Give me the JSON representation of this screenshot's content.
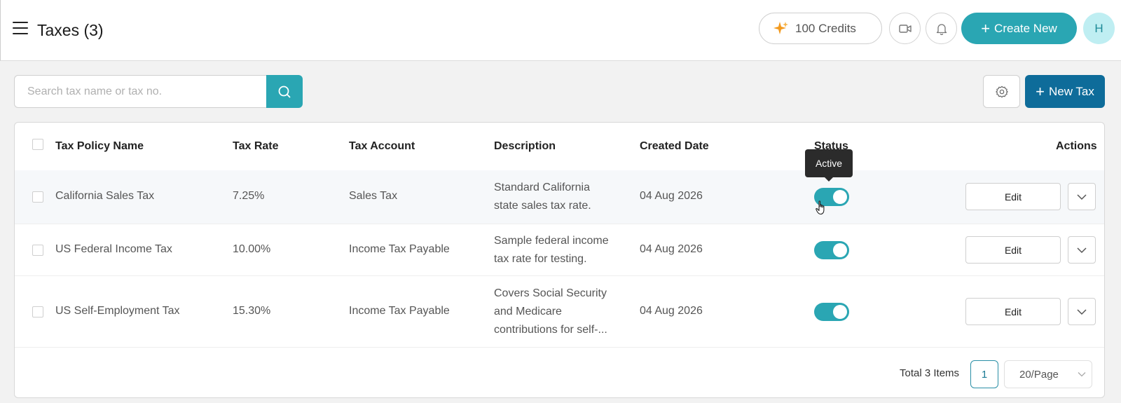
{
  "header": {
    "title": "Taxes (3)",
    "credits_label": "100 Credits",
    "create_label": "Create New",
    "avatar_initial": "H"
  },
  "toolbar": {
    "search_placeholder": "Search tax name or tax no.",
    "new_tax_label": "New Tax"
  },
  "table": {
    "columns": [
      "Tax Policy Name",
      "Tax Rate",
      "Tax Account",
      "Description",
      "Created Date",
      "Status",
      "Actions"
    ],
    "rows": [
      {
        "name": "California Sales Tax",
        "rate": "7.25%",
        "account": "Sales Tax",
        "desc_line1": "Standard California",
        "desc_line2": "state sales tax rate.",
        "created": "04 Aug 2026",
        "status_active": true,
        "edit_label": "Edit"
      },
      {
        "name": "US Federal Income Tax",
        "rate": "10.00%",
        "account": "Income Tax Payable",
        "desc_line1": "Sample federal income",
        "desc_line2": "tax rate for testing.",
        "created": "04 Aug 2026",
        "status_active": true,
        "edit_label": "Edit"
      },
      {
        "name": "US Self-Employment Tax",
        "rate": "15.30%",
        "account": "Income Tax Payable",
        "desc_line1": "Covers Social Security",
        "desc_line2": "and Medicare",
        "desc_line3": "contributions for self-...",
        "created": "04 Aug 2026",
        "status_active": true,
        "edit_label": "Edit"
      }
    ]
  },
  "tooltip": {
    "text": "Active"
  },
  "pagination": {
    "total_label": "Total 3 Items",
    "current_page": "1",
    "page_size": "20/Page"
  },
  "colors": {
    "accent": "#2aa6b3",
    "primary": "#0e6c9a",
    "credits_spark": "#f39a1e"
  }
}
